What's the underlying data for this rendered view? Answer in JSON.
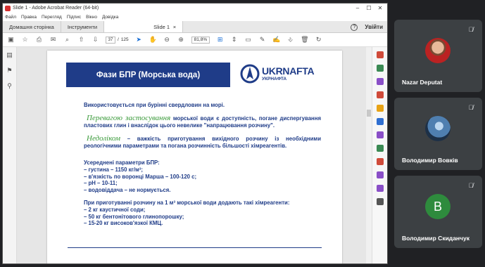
{
  "acrobat": {
    "window_title": "Slide 1 - Adobe Acrobat Reader (64-bit)",
    "menu": [
      "Файл",
      "Правка",
      "Перегляд",
      "Підпис",
      "Вікно",
      "Довідка"
    ],
    "tabs": {
      "home": "Домашня сторінка",
      "tools": "Інструменти",
      "document": "Slide 1",
      "document_close": "×"
    },
    "help": "?",
    "sign_in": "Увійти",
    "toolbar": {
      "current_page": "37",
      "page_sep": "/",
      "total_pages": "125",
      "zoom": "81,8%"
    }
  },
  "slide": {
    "title": "Фази БПР (Морська вода)",
    "logo": {
      "name": "UKRNAFTA",
      "subtitle": "УКРНАФТА"
    },
    "intro": "Використовується при бурінні свердловин на морі.",
    "advantage_lead": "Перевагою застосування",
    "advantage_text": " морської води є доступність, погане диспергування пластових глин і внаслідок цього невелике \"напрацювання розчину\".",
    "drawback_lead": "Недоліком",
    "drawback_text": " – важкість приготування вихідного розчину із необхідними реологічними параметрами  та погана розчинність більшості хімреагентів.",
    "params_header": "Усереднені параметри БПР:",
    "params": [
      "– густина – 1150 кг/м³;",
      "– в'язкість по воронці Марша – 100-120 с;",
      "– рН – 10-11;",
      "– водовіддача – не нормується."
    ],
    "reagents_header": "При приготуванні розчину на 1 м³ морської води додають такі хімреагенти:",
    "reagents": [
      "– 2 кг каустичної соди;",
      "– 50 кг бентонітового глинопорошку;",
      "– 15-20 кг високов'язкої КМЦ."
    ]
  },
  "participants": [
    {
      "name": "Nazar Deputat",
      "avatar": "photo"
    },
    {
      "name": "Володимир Вовків",
      "avatar": "photo"
    },
    {
      "name": "Володимир Скиданчук",
      "avatar_letter": "B"
    }
  ],
  "colors": {
    "slide_blue": "#1f3c88",
    "slide_green": "#3a9a3a",
    "tile_bg": "#3c4043",
    "avatar_green": "#2e8b3d"
  },
  "icons": {
    "mic_muted": "mic-off-icon"
  }
}
